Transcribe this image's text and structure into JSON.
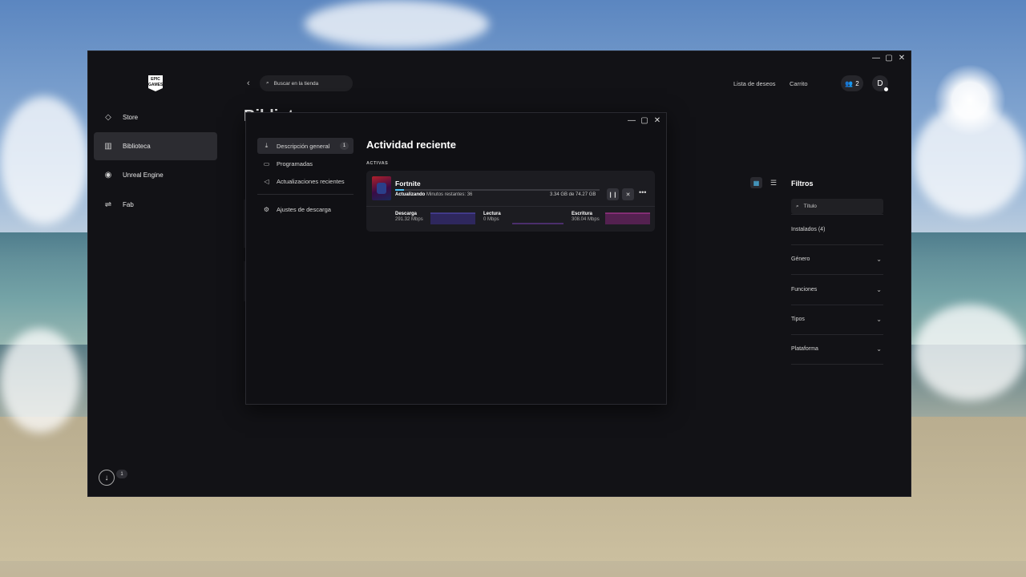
{
  "launcher": {
    "nav": [
      {
        "label": "Store",
        "icon": "tag-icon"
      },
      {
        "label": "Biblioteca",
        "icon": "library-icon"
      },
      {
        "label": "Unreal Engine",
        "icon": "unreal-icon"
      },
      {
        "label": "Fab",
        "icon": "fab-icon"
      }
    ],
    "logo_text": "EPIC GAMES",
    "search_placeholder": "Buscar en la tienda",
    "wishlist": "Lista de deseos",
    "cart": "Carrito",
    "friends_count": "2",
    "avatar_initial": "D",
    "downloads_badge": "1",
    "page_title": "Bibliot",
    "filters": {
      "title": "Filtros",
      "search_placeholder": "Título",
      "rows": [
        "Instalados (4)",
        "Género",
        "Funciones",
        "Tipos",
        "Plataforma"
      ]
    }
  },
  "downloads": {
    "menu": [
      {
        "label": "Descripción general",
        "icon": "download-icon",
        "badge": "1"
      },
      {
        "label": "Programadas",
        "icon": "calendar-icon"
      },
      {
        "label": "Actualizaciones recientes",
        "icon": "megaphone-icon"
      },
      {
        "label": "Ajustes de descarga",
        "icon": "gear-icon"
      }
    ],
    "heading": "Actividad reciente",
    "section": "ACTIVAS",
    "item": {
      "name": "Fortnite",
      "status": "Actualizando",
      "remaining": "Minutos restantes: 36",
      "size": "3.34 GB de 74.27 GB",
      "progress": 0.045
    },
    "stats": [
      {
        "label": "Descarga",
        "value": "291.32 Mbps",
        "color": "#5b4fc7"
      },
      {
        "label": "Lectura",
        "value": "0 Mbps",
        "color": "#7a3fb8"
      },
      {
        "label": "Escritura",
        "value": "308.04 Mbps",
        "color": "#c43aa8"
      }
    ]
  }
}
